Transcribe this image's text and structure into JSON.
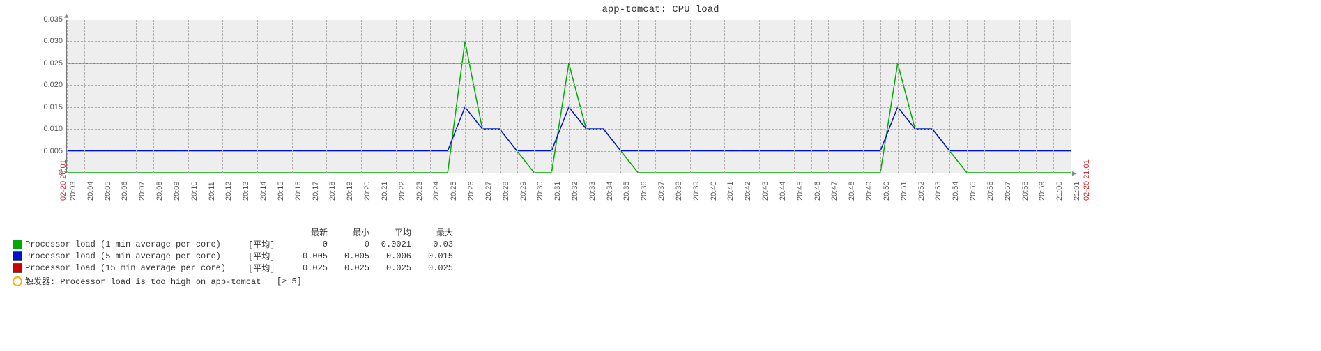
{
  "chart_data": {
    "type": "line",
    "title": "app-tomcat: CPU load",
    "xlabel": "",
    "ylabel": "",
    "ylim": [
      0,
      0.035
    ],
    "y_ticks": [
      0,
      0.005,
      0.01,
      0.015,
      0.02,
      0.025,
      0.03,
      0.035
    ],
    "x_categories_pre": [
      "02-20 20:01"
    ],
    "x_categories": [
      "20:03",
      "20:04",
      "20:05",
      "20:06",
      "20:07",
      "20:08",
      "20:09",
      "20:10",
      "20:11",
      "20:12",
      "20:13",
      "20:14",
      "20:15",
      "20:16",
      "20:17",
      "20:18",
      "20:19",
      "20:20",
      "20:21",
      "20:22",
      "20:23",
      "20:24",
      "20:25",
      "20:26",
      "20:27",
      "20:28",
      "20:29",
      "20:30",
      "20:31",
      "20:32",
      "20:33",
      "20:34",
      "20:35",
      "20:36",
      "20:37",
      "20:38",
      "20:39",
      "20:40",
      "20:41",
      "20:42",
      "20:43",
      "20:44",
      "20:45",
      "20:46",
      "20:47",
      "20:48",
      "20:49",
      "20:50",
      "20:51",
      "20:52",
      "20:53",
      "20:54",
      "20:55",
      "20:56",
      "20:57",
      "20:58",
      "20:59",
      "21:00",
      "21:01"
    ],
    "x_categories_post": [
      "02-20 21:01"
    ],
    "series": [
      {
        "name": "Processor load (1 min average per core)",
        "color": "#00aa00",
        "agg_label": "[平均]",
        "stats": {
          "latest": "0",
          "min": "0",
          "avg": "0.0021",
          "max": "0.03"
        },
        "values": [
          0,
          0,
          0,
          0,
          0,
          0,
          0,
          0,
          0,
          0,
          0,
          0,
          0,
          0,
          0,
          0,
          0,
          0,
          0,
          0,
          0,
          0,
          0,
          0.03,
          0.01,
          0.01,
          0.005,
          0.0,
          0,
          0.025,
          0.01,
          0.01,
          0.005,
          0.0,
          0,
          0,
          0,
          0,
          0,
          0,
          0,
          0,
          0,
          0,
          0,
          0,
          0,
          0,
          0.025,
          0.01,
          0.01,
          0.005,
          0.0,
          0,
          0,
          0,
          0,
          0,
          0
        ]
      },
      {
        "name": "Processor load (5 min average per core)",
        "color": "#0012cc",
        "agg_label": "[平均]",
        "stats": {
          "latest": "0.005",
          "min": "0.005",
          "avg": "0.006",
          "max": "0.015"
        },
        "values": [
          0.005,
          0.005,
          0.005,
          0.005,
          0.005,
          0.005,
          0.005,
          0.005,
          0.005,
          0.005,
          0.005,
          0.005,
          0.005,
          0.005,
          0.005,
          0.005,
          0.005,
          0.005,
          0.005,
          0.005,
          0.005,
          0.005,
          0.005,
          0.015,
          0.01,
          0.01,
          0.005,
          0.005,
          0.005,
          0.015,
          0.01,
          0.01,
          0.005,
          0.005,
          0.005,
          0.005,
          0.005,
          0.005,
          0.005,
          0.005,
          0.005,
          0.005,
          0.005,
          0.005,
          0.005,
          0.005,
          0.005,
          0.005,
          0.015,
          0.01,
          0.01,
          0.005,
          0.005,
          0.005,
          0.005,
          0.005,
          0.005,
          0.005,
          0.005
        ]
      },
      {
        "name": "Processor load (15 min average per core)",
        "color": "#cc0000",
        "agg_label": "[平均]",
        "stats": {
          "latest": "0.025",
          "min": "0.025",
          "avg": "0.025",
          "max": "0.025"
        },
        "values": [
          0.025,
          0.025,
          0.025,
          0.025,
          0.025,
          0.025,
          0.025,
          0.025,
          0.025,
          0.025,
          0.025,
          0.025,
          0.025,
          0.025,
          0.025,
          0.025,
          0.025,
          0.025,
          0.025,
          0.025,
          0.025,
          0.025,
          0.025,
          0.025,
          0.025,
          0.025,
          0.025,
          0.025,
          0.025,
          0.025,
          0.025,
          0.025,
          0.025,
          0.025,
          0.025,
          0.025,
          0.025,
          0.025,
          0.025,
          0.025,
          0.025,
          0.025,
          0.025,
          0.025,
          0.025,
          0.025,
          0.025,
          0.025,
          0.025,
          0.025,
          0.025,
          0.025,
          0.025,
          0.025,
          0.025,
          0.025,
          0.025,
          0.025,
          0.025
        ]
      }
    ]
  },
  "legend_headers": {
    "latest": "最新",
    "min": "最小",
    "avg": "平均",
    "max": "最大"
  },
  "trigger": {
    "label": "触发器: Processor load is too high on app-tomcat",
    "threshold": "[> 5]"
  }
}
